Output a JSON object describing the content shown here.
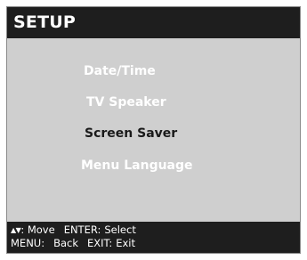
{
  "header": {
    "title": "SETUP"
  },
  "menu": {
    "items": [
      {
        "label": "Date/Time",
        "selected": false
      },
      {
        "label": "TV Speaker",
        "selected": false
      },
      {
        "label": "Screen Saver",
        "selected": true
      },
      {
        "label": "Menu Language",
        "selected": false
      }
    ]
  },
  "footer": {
    "nav_arrows": "▲▼",
    "move_label": ": Move",
    "select_key": "ENTER:",
    "select_label": "Select",
    "back_key": "MENU:",
    "back_label": "Back",
    "exit_key": "EXIT:",
    "exit_label": "Exit"
  },
  "colors": {
    "header_bg": "#1e1e1e",
    "body_bg": "#cfcfcf",
    "inactive_text": "#ffffff",
    "selected_text": "#1a1a1a"
  }
}
